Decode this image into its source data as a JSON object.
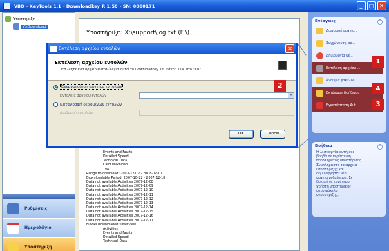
{
  "window": {
    "title": "VBO - KeyTools 1.1 - Downloadkey R 1.50 - SN: 0000171",
    "buttons": {
      "minimize": "_",
      "maximize": "□",
      "close": "✕"
    }
  },
  "tree": {
    "root": "Υποστήριξη",
    "child": "Y:\\Download"
  },
  "nav": {
    "settings": "Ρυθμίσεις",
    "calendar": "Ημερολόγιο",
    "support": "Υποστήριξη"
  },
  "document": {
    "header": "Υποστήριξη: X:\\support\\log.txt  (F:\\)",
    "lines_indented_top": [
      "Events and Faults",
      "Detailed Speed",
      "Technical Data",
      "Card download",
      "TVA"
    ],
    "lines": [
      "Range to download: 2007-12-07 - 2008-02-07",
      "Downloadable Period: 2007-10-22 - 2007-12-18",
      "Data not available Activities 2007-12-08",
      "Data not available Activities 2007-12-09",
      "Data not available Activities 2007-12-10",
      "Data not available Activities 2007-12-11",
      "Data not available Activities 2007-12-12",
      "Data not available Activities 2007-12-13",
      "Data not available Activities 2007-12-14",
      "Data not available Activities 2007-12-15",
      "Data not available Activities 2007-12-16",
      "Data not available Activities 2007-12-17",
      "Blocks downloaded: Overview"
    ],
    "lines_indented_bottom": [
      "Activities",
      "Events and Faults",
      "Detailed Speed",
      "Technical Data"
    ]
  },
  "actions": {
    "title": "Ενέργειες",
    "collapse": "⌃",
    "items": [
      "Διαγραφή αρχείο...",
      "Συγχώνευση αρ...",
      "Δημιουργία νέ...",
      "Εκτέλεση αρχείου ...",
      "Άνοιγμα φακέλου...",
      "Εκτύπωση βοήθειας",
      "Εγκατάσταση Aut..."
    ]
  },
  "help": {
    "title": "Βοήθεια",
    "collapse": "⌃",
    "text": [
      "Η λειτουργία αυτή σας",
      "βοηθά σε περίπτωση",
      "προβλήματος υποστήριξης.",
      "Συμπληρώστε τα αρχεία",
      "υποστήριξης και",
      "δημιουργήστε νέο",
      "αρχείο ρυθμίσεων. Σε",
      "δοκιμή σε ευρύτερο",
      "χρήστη υποστήριξης",
      "στον φάκελο",
      "υποστήριξης."
    ]
  },
  "dialog": {
    "title": "Εκτέλεση αρχείου εντολών",
    "close": "✕",
    "heading": "Εκτέλεση αρχείου εντολών",
    "subheading": "Επιλέξτε ένα αρχείο εντολών για αυτό το Downloadkey και κάντε κλικ στο \"OK\".",
    "radio1": "Ενεργοποίηση αρχείου εντολών",
    "field1_label": "Εντολεία αρχείου εντολών",
    "field1_value": "",
    "dropdown": "▾",
    "radio2": "Καταγραφή δεδομένων εντολών",
    "field2_label": "Διαδρομή εντολών",
    "ok": "OK",
    "cancel": "Cancel"
  },
  "badges": [
    "1",
    "2",
    "3",
    "4"
  ],
  "colors": {
    "accent": "#1556d2",
    "badge": "#d21d1d",
    "highlight": "#8a2f33"
  }
}
